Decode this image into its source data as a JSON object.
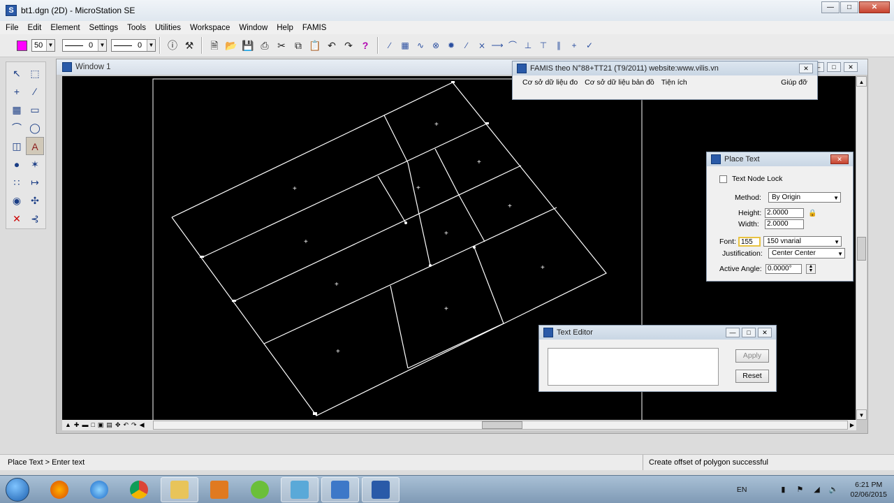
{
  "window": {
    "title": "bt1.dgn (2D) - MicroStation SE"
  },
  "menu": [
    "File",
    "Edit",
    "Element",
    "Settings",
    "Tools",
    "Utilities",
    "Workspace",
    "Window",
    "Help",
    "FAMIS"
  ],
  "toolbar": {
    "level": "50",
    "style_value": "0",
    "weight_value": "0",
    "active_color": "#ff00ff"
  },
  "view": {
    "title": "Window 1"
  },
  "famis": {
    "title": "FAMIS theo N°88+TT21 (T9/2011)  website:www.vilis.vn",
    "menu": [
      "Cơ sở dữ liệu đo",
      "Cơ sở dữ liệu bản đồ",
      "Tiện ích"
    ],
    "help": "Giúp đỡ"
  },
  "place_text": {
    "title": "Place Text",
    "text_node_lock": "Text Node Lock",
    "method_label": "Method:",
    "method_value": "By Origin",
    "height_label": "Height:",
    "height_value": "2.0000",
    "width_label": "Width:",
    "width_value": "2.0000",
    "font_label": "Font:",
    "font_number": "155",
    "font_value": "150  vnarial",
    "justification_label": "Justification:",
    "justification_value": "Center Center",
    "angle_label": "Active Angle:",
    "angle_value": "0.0000°"
  },
  "text_editor": {
    "title": "Text Editor",
    "apply": "Apply",
    "reset": "Reset"
  },
  "status": {
    "left": "Place Text > Enter text",
    "right": "Create offset of polygon successful"
  },
  "tray": {
    "lang": "EN",
    "time": "6:21 PM",
    "date": "02/06/2015"
  }
}
